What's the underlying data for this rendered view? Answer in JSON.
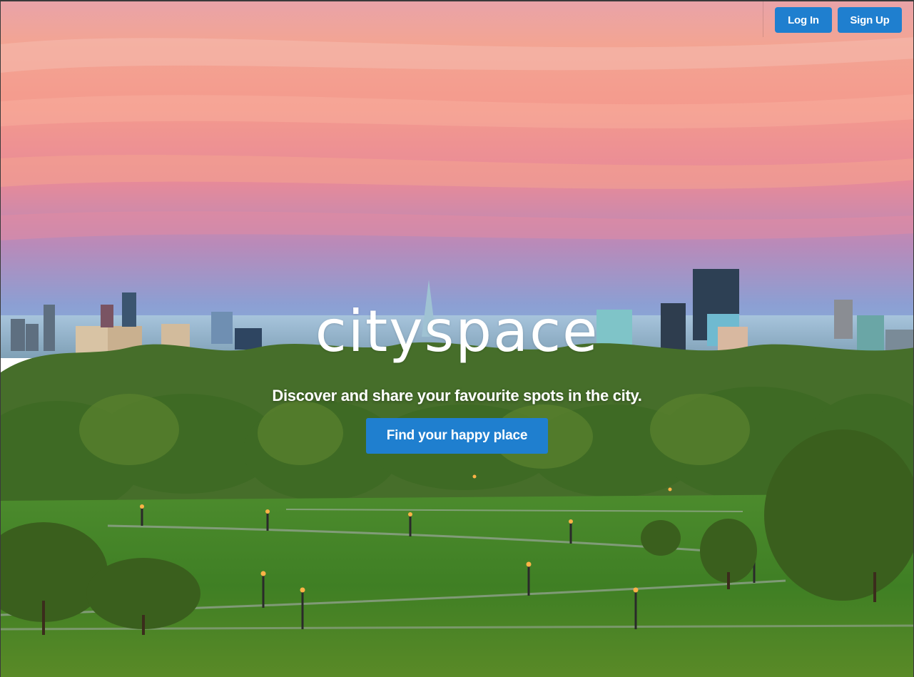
{
  "header": {
    "login_label": "Log In",
    "signup_label": "Sign Up"
  },
  "hero": {
    "logo_text": "cityspace",
    "tagline": "Discover and share your favourite spots in the city.",
    "cta_label": "Find your happy place"
  },
  "colors": {
    "accent": "#1f7fcf",
    "text_on_hero": "#ffffff"
  }
}
